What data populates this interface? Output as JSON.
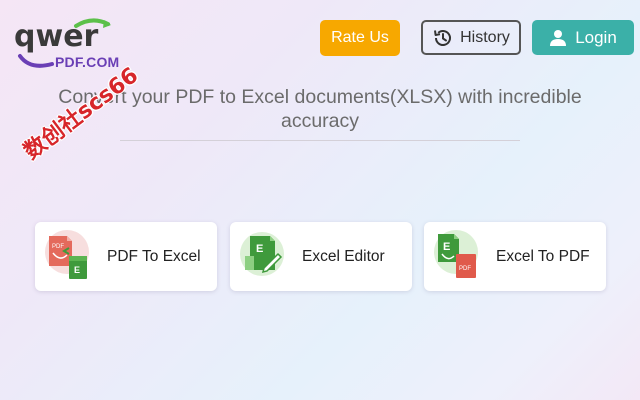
{
  "logo": {
    "wordmark": "qwer",
    "subtext": "PDF.COM"
  },
  "header": {
    "rate_label": "Rate Us",
    "history_label": "History",
    "login_label": "Login"
  },
  "headline": "Convert your PDF to Excel documents(XLSX) with incredible accuracy",
  "watermark": "数创社scs66",
  "cards": [
    {
      "label": "PDF To Excel",
      "icon": "pdf-to-excel-icon"
    },
    {
      "label": "Excel Editor",
      "icon": "excel-editor-icon"
    },
    {
      "label": "Excel To PDF",
      "icon": "excel-to-pdf-icon"
    }
  ],
  "colors": {
    "rate_bg": "#f7a800",
    "login_bg": "#3bb0a8",
    "excel_green": "#3f9a3c",
    "pdf_red": "#e05a4b",
    "logo_purple": "#6a3fb5"
  }
}
